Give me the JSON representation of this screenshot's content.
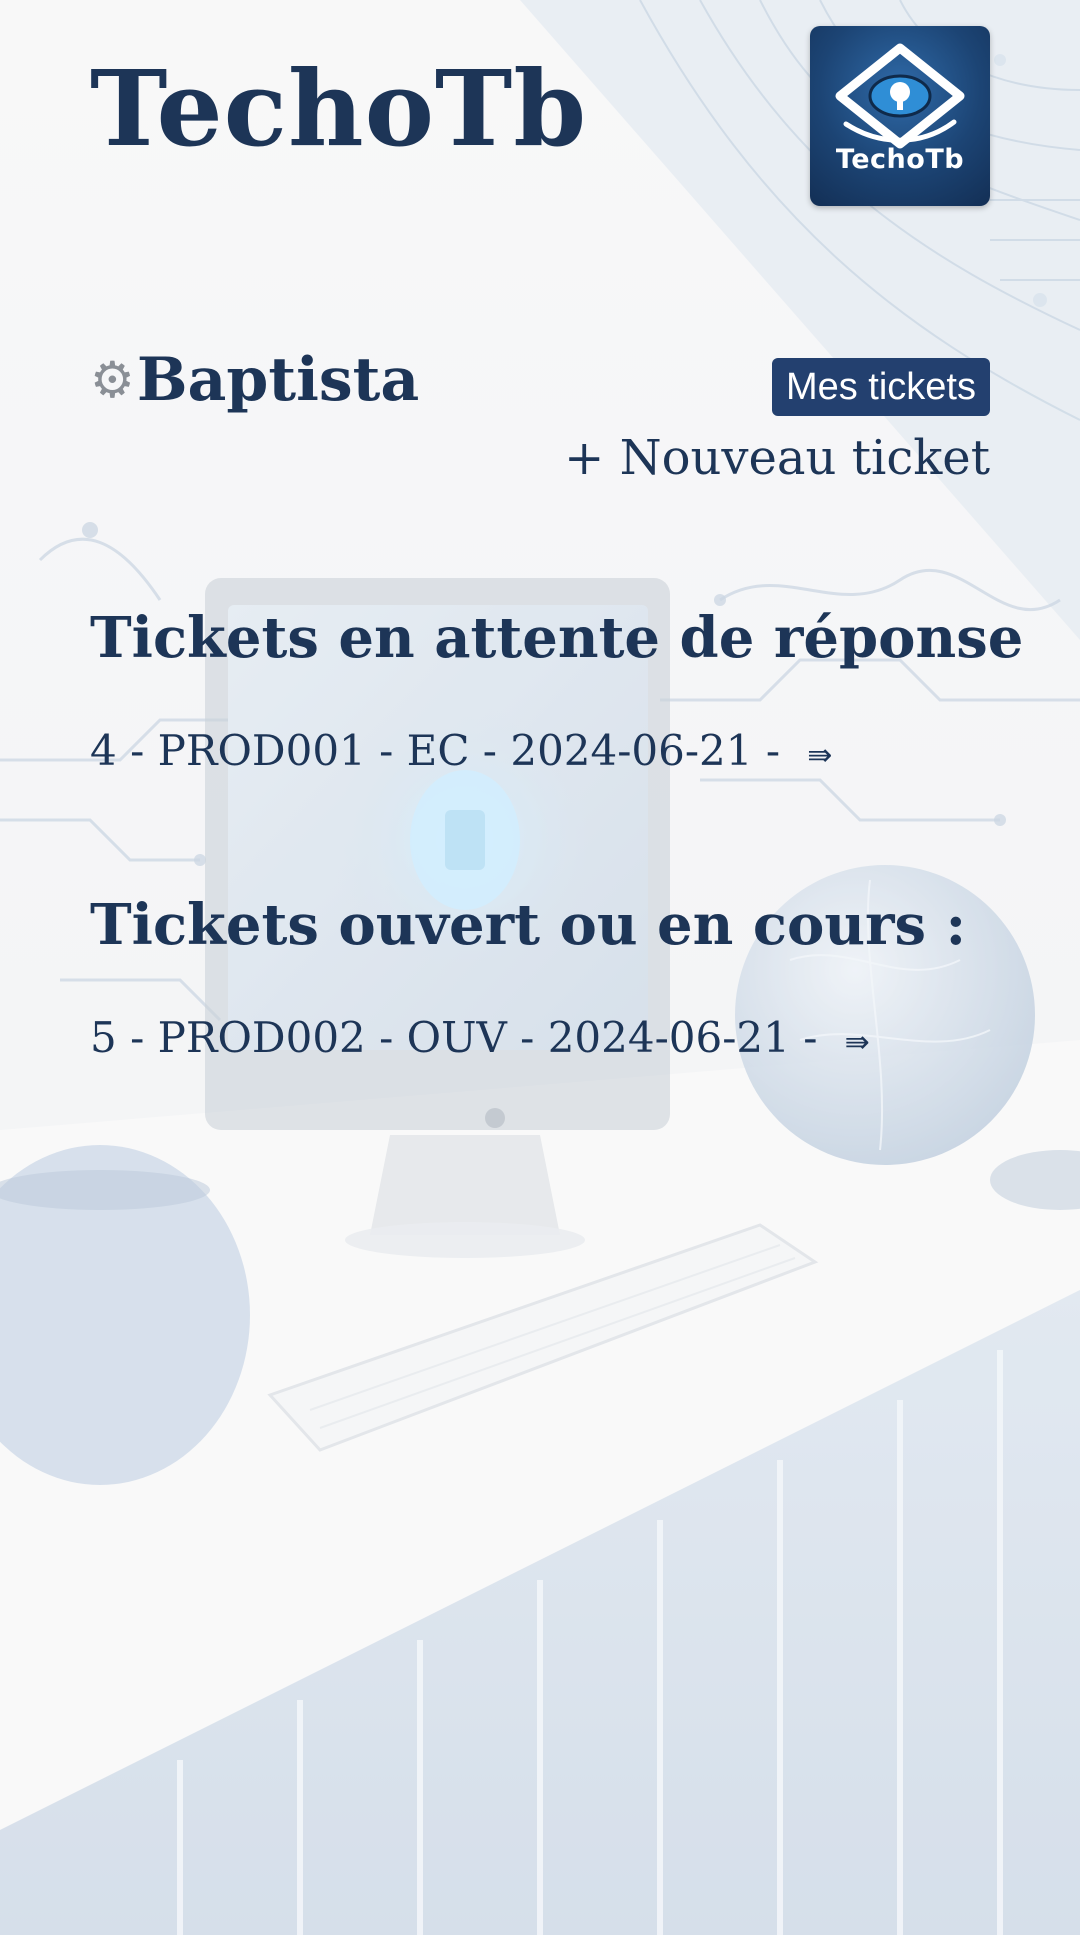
{
  "brand": {
    "title": "TechoTb",
    "logo_text": "TechoTb"
  },
  "user": {
    "icon": "gear-icon",
    "name": "Baptista"
  },
  "nav": {
    "my_tickets_label": "Mes tickets",
    "new_ticket_label": "+ Nouveau ticket"
  },
  "sections": [
    {
      "title": "Tickets en attente de réponse",
      "tickets": [
        {
          "text": "4 - PROD001 - EC - 2024-06-21 -",
          "arrow": "⇛"
        }
      ]
    },
    {
      "title": "Tickets ouvert ou en cours :",
      "tickets": [
        {
          "text": "5 - PROD002 - OUV - 2024-06-21 -",
          "arrow": "⇛"
        }
      ]
    }
  ],
  "colors": {
    "primary": "#1d3557",
    "button_bg": "#23406f",
    "button_text": "#ffffff"
  }
}
